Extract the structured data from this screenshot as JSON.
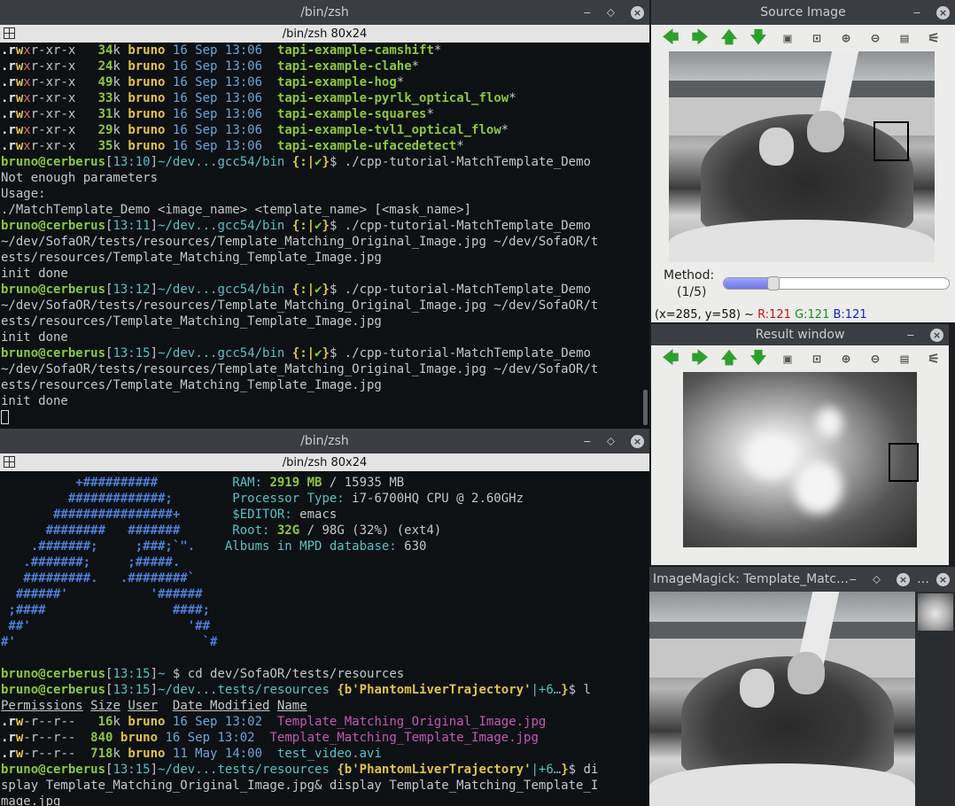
{
  "top_terminal": {
    "title": "/bin/zsh",
    "subtitle": "/bin/zsh 80x24",
    "lines": [
      [
        {
          "t": ".r",
          "c": "w"
        },
        {
          "t": "w",
          "c": "y"
        },
        {
          "t": "x",
          "c": "r"
        },
        {
          "t": "r-xr-x   ",
          "c": ""
        },
        {
          "t": "34",
          "c": "g"
        },
        {
          "t": "k ",
          "c": ""
        },
        {
          "t": "bruno ",
          "c": "y"
        },
        {
          "t": "16 Sep 13:06  ",
          "c": "b"
        },
        {
          "t": "tapi-example-camshift",
          "c": "g"
        },
        {
          "t": "*",
          "c": ""
        }
      ],
      [
        {
          "t": ".r",
          "c": "w"
        },
        {
          "t": "w",
          "c": "y"
        },
        {
          "t": "x",
          "c": "r"
        },
        {
          "t": "r-xr-x   ",
          "c": ""
        },
        {
          "t": "24",
          "c": "g"
        },
        {
          "t": "k ",
          "c": ""
        },
        {
          "t": "bruno ",
          "c": "y"
        },
        {
          "t": "16 Sep 13:06  ",
          "c": "b"
        },
        {
          "t": "tapi-example-clahe",
          "c": "g"
        },
        {
          "t": "*",
          "c": ""
        }
      ],
      [
        {
          "t": ".r",
          "c": "w"
        },
        {
          "t": "w",
          "c": "y"
        },
        {
          "t": "x",
          "c": "r"
        },
        {
          "t": "r-xr-x   ",
          "c": ""
        },
        {
          "t": "49",
          "c": "g"
        },
        {
          "t": "k ",
          "c": ""
        },
        {
          "t": "bruno ",
          "c": "y"
        },
        {
          "t": "16 Sep 13:06  ",
          "c": "b"
        },
        {
          "t": "tapi-example-hog",
          "c": "g"
        },
        {
          "t": "*",
          "c": ""
        }
      ],
      [
        {
          "t": ".r",
          "c": "w"
        },
        {
          "t": "w",
          "c": "y"
        },
        {
          "t": "x",
          "c": "r"
        },
        {
          "t": "r-xr-x   ",
          "c": ""
        },
        {
          "t": "33",
          "c": "g"
        },
        {
          "t": "k ",
          "c": ""
        },
        {
          "t": "bruno ",
          "c": "y"
        },
        {
          "t": "16 Sep 13:06  ",
          "c": "b"
        },
        {
          "t": "tapi-example-pyrlk_optical_flow",
          "c": "g"
        },
        {
          "t": "*",
          "c": ""
        }
      ],
      [
        {
          "t": ".r",
          "c": "w"
        },
        {
          "t": "w",
          "c": "y"
        },
        {
          "t": "x",
          "c": "r"
        },
        {
          "t": "r-xr-x   ",
          "c": ""
        },
        {
          "t": "31",
          "c": "g"
        },
        {
          "t": "k ",
          "c": ""
        },
        {
          "t": "bruno ",
          "c": "y"
        },
        {
          "t": "16 Sep 13:06  ",
          "c": "b"
        },
        {
          "t": "tapi-example-squares",
          "c": "g"
        },
        {
          "t": "*",
          "c": ""
        }
      ],
      [
        {
          "t": ".r",
          "c": "w"
        },
        {
          "t": "w",
          "c": "y"
        },
        {
          "t": "x",
          "c": "r"
        },
        {
          "t": "r-xr-x   ",
          "c": ""
        },
        {
          "t": "29",
          "c": "g"
        },
        {
          "t": "k ",
          "c": ""
        },
        {
          "t": "bruno ",
          "c": "y"
        },
        {
          "t": "16 Sep 13:06  ",
          "c": "b"
        },
        {
          "t": "tapi-example-tvl1_optical_flow",
          "c": "g"
        },
        {
          "t": "*",
          "c": ""
        }
      ],
      [
        {
          "t": ".r",
          "c": "w"
        },
        {
          "t": "w",
          "c": "y"
        },
        {
          "t": "x",
          "c": "r"
        },
        {
          "t": "r-xr-x   ",
          "c": ""
        },
        {
          "t": "35",
          "c": "g"
        },
        {
          "t": "k ",
          "c": ""
        },
        {
          "t": "bruno ",
          "c": "y"
        },
        {
          "t": "16 Sep 13:06  ",
          "c": "b"
        },
        {
          "t": "tapi-example-ufacedetect",
          "c": "g"
        },
        {
          "t": "*",
          "c": ""
        }
      ],
      [
        {
          "t": "bruno@cerberus",
          "c": "g"
        },
        {
          "t": "[",
          "c": ""
        },
        {
          "t": "13:10",
          "c": "c"
        },
        {
          "t": "]",
          "c": ""
        },
        {
          "t": "~/dev...gcc54/bin ",
          "c": "c"
        },
        {
          "t": "{:|",
          "c": "y"
        },
        {
          "t": "✔",
          "c": "g"
        },
        {
          "t": "}",
          "c": "y"
        },
        {
          "t": "$ ./cpp-tutorial-MatchTemplate_Demo",
          "c": ""
        }
      ],
      [
        {
          "t": "Not enough parameters",
          "c": ""
        }
      ],
      [
        {
          "t": "Usage:",
          "c": ""
        }
      ],
      [
        {
          "t": "./MatchTemplate_Demo <image_name> <template_name> [<mask_name>]",
          "c": ""
        }
      ],
      [
        {
          "t": "bruno@cerberus",
          "c": "g"
        },
        {
          "t": "[",
          "c": ""
        },
        {
          "t": "13:11",
          "c": "c"
        },
        {
          "t": "]",
          "c": ""
        },
        {
          "t": "~/dev...gcc54/bin ",
          "c": "c"
        },
        {
          "t": "{:|",
          "c": "y"
        },
        {
          "t": "✔",
          "c": "g"
        },
        {
          "t": "}",
          "c": "y"
        },
        {
          "t": "$ ./cpp-tutorial-MatchTemplate_Demo",
          "c": ""
        }
      ],
      [
        {
          "t": "~/dev/SofaOR/tests/resources/Template_Matching_Original_Image.jpg ~/dev/SofaOR/t",
          "c": ""
        }
      ],
      [
        {
          "t": "ests/resources/Template_Matching_Template_Image.jpg",
          "c": ""
        }
      ],
      [
        {
          "t": "init done",
          "c": ""
        }
      ],
      [
        {
          "t": "bruno@cerberus",
          "c": "g"
        },
        {
          "t": "[",
          "c": ""
        },
        {
          "t": "13:12",
          "c": "c"
        },
        {
          "t": "]",
          "c": ""
        },
        {
          "t": "~/dev...gcc54/bin ",
          "c": "c"
        },
        {
          "t": "{:|",
          "c": "y"
        },
        {
          "t": "✔",
          "c": "g"
        },
        {
          "t": "}",
          "c": "y"
        },
        {
          "t": "$ ./cpp-tutorial-MatchTemplate_Demo",
          "c": ""
        }
      ],
      [
        {
          "t": "~/dev/SofaOR/tests/resources/Template_Matching_Original_Image.jpg ~/dev/SofaOR/t",
          "c": ""
        }
      ],
      [
        {
          "t": "ests/resources/Template_Matching_Template_Image.jpg",
          "c": ""
        }
      ],
      [
        {
          "t": "init done",
          "c": ""
        }
      ],
      [
        {
          "t": "bruno@cerberus",
          "c": "g"
        },
        {
          "t": "[",
          "c": ""
        },
        {
          "t": "13:15",
          "c": "c"
        },
        {
          "t": "]",
          "c": ""
        },
        {
          "t": "~/dev...gcc54/bin ",
          "c": "c"
        },
        {
          "t": "{:|",
          "c": "y"
        },
        {
          "t": "✔",
          "c": "g"
        },
        {
          "t": "}",
          "c": "y"
        },
        {
          "t": "$ ./cpp-tutorial-MatchTemplate_Demo",
          "c": ""
        }
      ],
      [
        {
          "t": "~/dev/SofaOR/tests/resources/Template_Matching_Original_Image.jpg ~/dev/SofaOR/t",
          "c": ""
        }
      ],
      [
        {
          "t": "ests/resources/Template_Matching_Template_Image.jpg",
          "c": ""
        }
      ],
      [
        {
          "t": "init done",
          "c": ""
        }
      ]
    ]
  },
  "bottom_terminal": {
    "title": "/bin/zsh",
    "subtitle": "/bin/zsh 80x24",
    "lines": [
      [
        {
          "t": "          +##########          ",
          "c": "bl"
        },
        {
          "t": "RAM: ",
          "c": "c"
        },
        {
          "t": "2919 MB",
          "c": "g"
        },
        {
          "t": " / 15935 MB",
          "c": ""
        }
      ],
      [
        {
          "t": "         #############;        ",
          "c": "bl"
        },
        {
          "t": "Processor Type: ",
          "c": "c"
        },
        {
          "t": "i7-6700HQ CPU @ 2.60GHz",
          "c": ""
        }
      ],
      [
        {
          "t": "       ################+       ",
          "c": "bl"
        },
        {
          "t": "$EDITOR: ",
          "c": "c"
        },
        {
          "t": "emacs",
          "c": ""
        }
      ],
      [
        {
          "t": "      ########   #######       ",
          "c": "bl"
        },
        {
          "t": "Root: ",
          "c": "c"
        },
        {
          "t": "32G",
          "c": "g"
        },
        {
          "t": " / 98G (32%) (ext4)",
          "c": ""
        }
      ],
      [
        {
          "t": "    .#######;     ;###;`\".    ",
          "c": "bl"
        },
        {
          "t": "Albums in MPD database: ",
          "c": "c"
        },
        {
          "t": "630",
          "c": ""
        }
      ],
      [
        {
          "t": "   .#######;     ;#####.",
          "c": "bl"
        }
      ],
      [
        {
          "t": "   #########.   .########`",
          "c": "bl"
        }
      ],
      [
        {
          "t": "  ######'           '######",
          "c": "bl"
        }
      ],
      [
        {
          "t": " ;####                 ####;",
          "c": "bl"
        }
      ],
      [
        {
          "t": " ##'                     '##",
          "c": "bl"
        }
      ],
      [
        {
          "t": "#'                         `#",
          "c": "bl"
        }
      ],
      [
        {
          "t": "",
          "c": ""
        }
      ],
      [
        {
          "t": "bruno@cerberus",
          "c": "g"
        },
        {
          "t": "[",
          "c": ""
        },
        {
          "t": "13:15",
          "c": "c"
        },
        {
          "t": "]",
          "c": ""
        },
        {
          "t": "~ ",
          "c": "c"
        },
        {
          "t": "$ cd dev/SofaOR/tests/resources",
          "c": ""
        }
      ],
      [
        {
          "t": "bruno@cerberus",
          "c": "g"
        },
        {
          "t": "[",
          "c": ""
        },
        {
          "t": "13:15",
          "c": "c"
        },
        {
          "t": "]",
          "c": ""
        },
        {
          "t": "~/dev...tests/resources ",
          "c": "c"
        },
        {
          "t": "{",
          "c": "y"
        },
        {
          "t": "b'PhantomLiverTrajectory'",
          "c": "y"
        },
        {
          "t": "|+6…",
          "c": "c"
        },
        {
          "t": "}",
          "c": "y"
        },
        {
          "t": "$ l",
          "c": ""
        }
      ],
      [
        {
          "t": "Permissions",
          "c": "u"
        },
        {
          "t": " ",
          "c": ""
        },
        {
          "t": "Size",
          "c": "u"
        },
        {
          "t": " ",
          "c": ""
        },
        {
          "t": "User",
          "c": "u"
        },
        {
          "t": "  ",
          "c": ""
        },
        {
          "t": "Date Modified",
          "c": "u"
        },
        {
          "t": " ",
          "c": ""
        },
        {
          "t": "Name",
          "c": "u"
        }
      ],
      [
        {
          "t": ".r",
          "c": "w"
        },
        {
          "t": "w",
          "c": "y"
        },
        {
          "t": "-r--r--   ",
          "c": ""
        },
        {
          "t": "16",
          "c": "g"
        },
        {
          "t": "k ",
          "c": ""
        },
        {
          "t": "bruno ",
          "c": "y"
        },
        {
          "t": "16 Sep 13:02  ",
          "c": "b"
        },
        {
          "t": "Template_Matching_Original_Image.jpg",
          "c": "p"
        }
      ],
      [
        {
          "t": ".r",
          "c": "w"
        },
        {
          "t": "w",
          "c": "y"
        },
        {
          "t": "-r--r--  ",
          "c": ""
        },
        {
          "t": "840",
          "c": "g"
        },
        {
          "t": " ",
          "c": ""
        },
        {
          "t": "bruno ",
          "c": "y"
        },
        {
          "t": "16 Sep 13:02  ",
          "c": "b"
        },
        {
          "t": "Template_Matching_Template_Image.jpg",
          "c": "p"
        }
      ],
      [
        {
          "t": ".r",
          "c": "w"
        },
        {
          "t": "w",
          "c": "y"
        },
        {
          "t": "-r--r--  ",
          "c": ""
        },
        {
          "t": "718",
          "c": "g"
        },
        {
          "t": "k ",
          "c": ""
        },
        {
          "t": "bruno ",
          "c": "y"
        },
        {
          "t": "11 May 14:00  ",
          "c": "b"
        },
        {
          "t": "test_video.avi",
          "c": "c"
        }
      ],
      [
        {
          "t": "bruno@cerberus",
          "c": "g"
        },
        {
          "t": "[",
          "c": ""
        },
        {
          "t": "13:15",
          "c": "c"
        },
        {
          "t": "]",
          "c": ""
        },
        {
          "t": "~/dev...tests/resources ",
          "c": "c"
        },
        {
          "t": "{",
          "c": "y"
        },
        {
          "t": "b'PhantomLiverTrajectory'",
          "c": "y"
        },
        {
          "t": "|+6…",
          "c": "c"
        },
        {
          "t": "}",
          "c": "y"
        },
        {
          "t": "$ di",
          "c": ""
        }
      ],
      [
        {
          "t": "splay Template_Matching_Original_Image.jpg& display Template_Matching_Template_I",
          "c": ""
        }
      ],
      [
        {
          "t": "mage.jpg",
          "c": ""
        }
      ]
    ]
  },
  "source_window": {
    "title": "Source Image",
    "method_label": "Method:",
    "method_value": "(1/5)",
    "slider_value": 0.22,
    "status_coords": "(x=285, y=58) ~",
    "status_r": "R:121",
    "status_g": "G:121",
    "status_b": "B:121"
  },
  "result_window": {
    "title": "Result window"
  },
  "magick_window": {
    "title": "ImageMagick: Template_Matc…"
  },
  "small_window": {
    "title": "…"
  },
  "window_controls": {
    "minimize": "‒",
    "maximize": "⬦",
    "close": "×"
  },
  "colors": {
    "terminal_bg": "#0d1114",
    "titlebar_bg": "#3a3e42",
    "prompt_green": "#8ec63f",
    "user_yellow": "#e0c34b"
  }
}
